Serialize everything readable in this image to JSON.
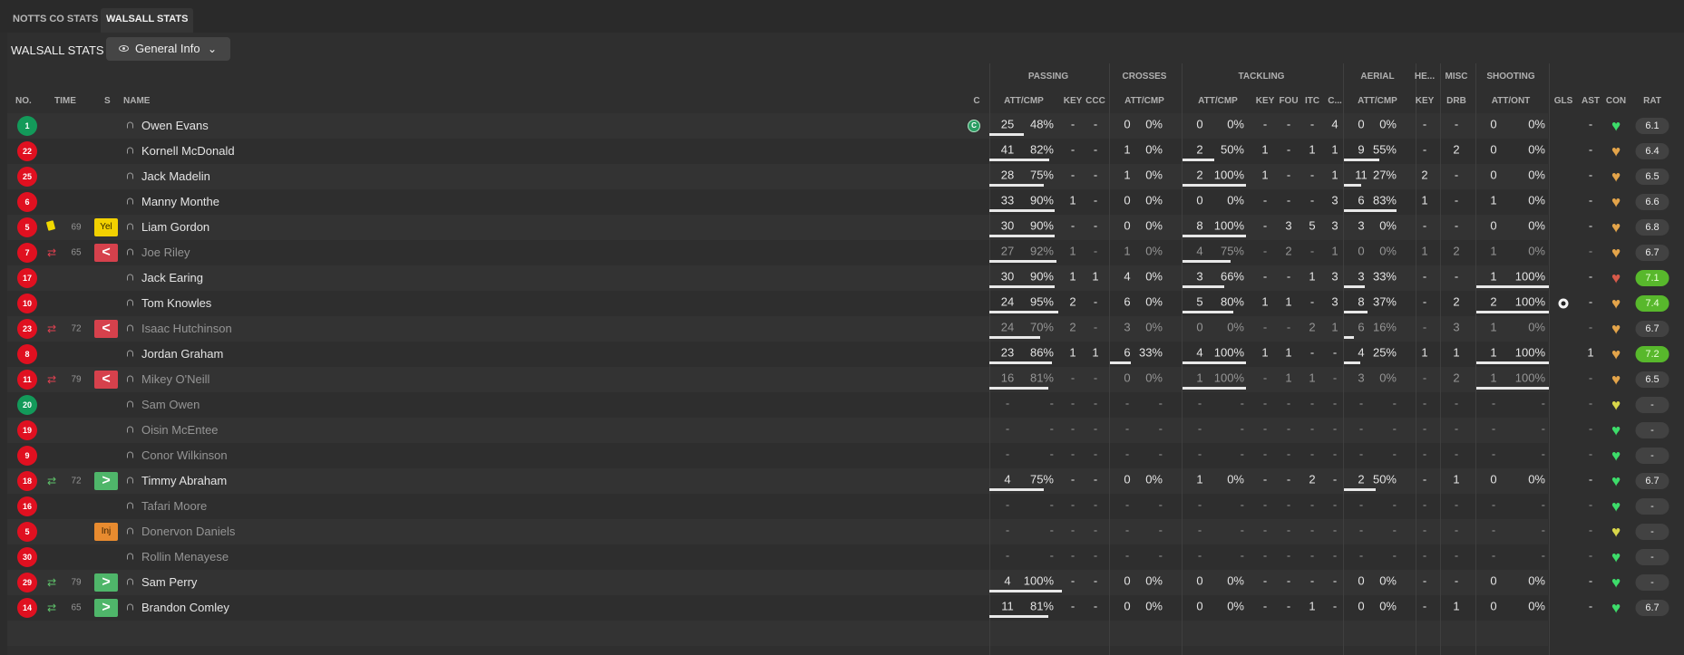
{
  "tabs": [
    {
      "label": "NOTTS CO STATS"
    },
    {
      "label": "WALSALL STATS"
    }
  ],
  "panel": {
    "title": "WALSALL STATS",
    "view": "General Info"
  },
  "colors": {
    "shirt_red": "#e01020",
    "shirt_green": "#139a5a",
    "rating_high": "#58b82c",
    "sub_off": "#d6414c",
    "sub_on": "#4fb66a",
    "yellow": "#f2d100",
    "injury": "#e88b2f"
  },
  "icons": {
    "eye": "eye-icon",
    "chevron": "chevron-down-icon",
    "person": "person-icon",
    "heart": "heart-icon",
    "captain": "captain-icon",
    "ball": "ball-icon",
    "sub_off": "sub-off-arrow-icon",
    "sub_on": "sub-on-arrow-icon",
    "yellow_card": "yellow-card-icon"
  },
  "groups": [
    "PASSING",
    "CROSSES",
    "TACKLING",
    "AERIAL",
    "HE...",
    "MISC",
    "SHOOTING"
  ],
  "columns": [
    "NO.",
    "TIME",
    "S",
    "NAME",
    "C",
    "ATT/CMP",
    "KEY",
    "CCC",
    "ATT/CMP",
    "ATT/CMP",
    "KEY",
    "FOU",
    "ITC",
    "C...",
    "ATT/CMP",
    "KEY",
    "DRB",
    "ATT/ONT",
    "GLS",
    "AST",
    "CON",
    "RAT"
  ],
  "players": [
    {
      "no": "1",
      "shirt": "green",
      "name": "Owen Evans",
      "captain": "C",
      "pass": [
        "25",
        "48%",
        0.48
      ],
      "pkey": "-",
      "ccc": "-",
      "cross": [
        "0",
        "0%",
        0
      ],
      "tack": [
        "0",
        "0%",
        0
      ],
      "tkey": "-",
      "fou": "-",
      "itc": "-",
      "tc": "4",
      "aer": [
        "0",
        "0%",
        0
      ],
      "hkey": "-",
      "drb": "-",
      "shoot": [
        "0",
        "0%",
        0
      ],
      "ast": "-",
      "heart": "green",
      "rat": "6.1"
    },
    {
      "no": "22",
      "name": "Kornell McDonald",
      "pass": [
        "41",
        "82%",
        0.82
      ],
      "pkey": "-",
      "ccc": "-",
      "cross": [
        "1",
        "0%",
        0
      ],
      "tack": [
        "2",
        "50%",
        0.5
      ],
      "tkey": "1",
      "fou": "-",
      "itc": "1",
      "tc": "1",
      "aer": [
        "9",
        "55%",
        0.55
      ],
      "hkey": "-",
      "drb": "2",
      "shoot": [
        "0",
        "0%",
        0
      ],
      "ast": "-",
      "heart": "orange",
      "rat": "6.4"
    },
    {
      "no": "25",
      "name": "Jack Madelin",
      "pass": [
        "28",
        "75%",
        0.75
      ],
      "pkey": "-",
      "ccc": "-",
      "cross": [
        "1",
        "0%",
        0
      ],
      "tack": [
        "2",
        "100%",
        1
      ],
      "tkey": "1",
      "fou": "-",
      "itc": "-",
      "tc": "1",
      "aer": [
        "11",
        "27%",
        0.27
      ],
      "hkey": "2",
      "drb": "-",
      "shoot": [
        "0",
        "0%",
        0
      ],
      "ast": "-",
      "heart": "orange",
      "rat": "6.5"
    },
    {
      "no": "6",
      "name": "Manny Monthe",
      "pass": [
        "33",
        "90%",
        0.9
      ],
      "pkey": "1",
      "ccc": "-",
      "cross": [
        "0",
        "0%",
        0
      ],
      "tack": [
        "0",
        "0%",
        0
      ],
      "tkey": "-",
      "fou": "-",
      "itc": "-",
      "tc": "3",
      "aer": [
        "6",
        "83%",
        0.83
      ],
      "hkey": "1",
      "drb": "-",
      "shoot": [
        "1",
        "0%",
        0
      ],
      "ast": "-",
      "heart": "orange",
      "rat": "6.6"
    },
    {
      "no": "5",
      "card": true,
      "time": "69",
      "badge": "Yel",
      "name": "Liam Gordon",
      "pass": [
        "30",
        "90%",
        0.9
      ],
      "pkey": "-",
      "ccc": "-",
      "cross": [
        "0",
        "0%",
        0
      ],
      "tack": [
        "8",
        "100%",
        1
      ],
      "tkey": "-",
      "fou": "3",
      "itc": "5",
      "tc": "3",
      "aer": [
        "3",
        "0%",
        0
      ],
      "hkey": "-",
      "drb": "-",
      "shoot": [
        "0",
        "0%",
        0
      ],
      "ast": "-",
      "heart": "orange",
      "rat": "6.8"
    },
    {
      "no": "7",
      "sub": "off",
      "time": "65",
      "badge": "<",
      "dim": true,
      "name": "Joe Riley",
      "pass": [
        "27",
        "92%",
        0.92
      ],
      "pkey": "1",
      "ccc": "-",
      "cross": [
        "1",
        "0%",
        0
      ],
      "tack": [
        "4",
        "75%",
        0.75
      ],
      "tkey": "-",
      "fou": "2",
      "itc": "-",
      "tc": "1",
      "aer": [
        "0",
        "0%",
        0
      ],
      "hkey": "1",
      "drb": "2",
      "shoot": [
        "1",
        "0%",
        0
      ],
      "ast": "-",
      "heart": "orange",
      "rat": "6.7"
    },
    {
      "no": "17",
      "name": "Jack Earing",
      "pass": [
        "30",
        "90%",
        0.9
      ],
      "pkey": "1",
      "ccc": "1",
      "cross": [
        "4",
        "0%",
        0
      ],
      "tack": [
        "3",
        "66%",
        0.66
      ],
      "tkey": "-",
      "fou": "-",
      "itc": "1",
      "tc": "3",
      "aer": [
        "3",
        "33%",
        0.33
      ],
      "hkey": "-",
      "drb": "-",
      "shoot": [
        "1",
        "100%",
        1
      ],
      "ast": "-",
      "heart": "red",
      "rat": "7.1",
      "rathi": true
    },
    {
      "no": "10",
      "name": "Tom Knowles",
      "pass": [
        "24",
        "95%",
        0.95
      ],
      "pkey": "2",
      "ccc": "-",
      "cross": [
        "6",
        "0%",
        0
      ],
      "tack": [
        "5",
        "80%",
        0.8
      ],
      "tkey": "1",
      "fou": "1",
      "itc": "-",
      "tc": "3",
      "aer": [
        "8",
        "37%",
        0.37
      ],
      "hkey": "-",
      "drb": "2",
      "shoot": [
        "2",
        "100%",
        1
      ],
      "goal": true,
      "ast": "-",
      "heart": "orange",
      "rat": "7.4",
      "rathi": true
    },
    {
      "no": "23",
      "sub": "off",
      "time": "72",
      "badge": "<",
      "dim": true,
      "name": "Isaac Hutchinson",
      "pass": [
        "24",
        "70%",
        0.7
      ],
      "pkey": "2",
      "ccc": "-",
      "cross": [
        "3",
        "0%",
        0
      ],
      "tack": [
        "0",
        "0%",
        0
      ],
      "tkey": "-",
      "fou": "-",
      "itc": "2",
      "tc": "1",
      "aer": [
        "6",
        "16%",
        0.16
      ],
      "hkey": "-",
      "drb": "3",
      "shoot": [
        "1",
        "0%",
        0
      ],
      "ast": "-",
      "heart": "orange",
      "rat": "6.7"
    },
    {
      "no": "8",
      "name": "Jordan Graham",
      "pass": [
        "23",
        "86%",
        0.86
      ],
      "pkey": "1",
      "ccc": "1",
      "cross": [
        "6",
        "33%",
        0.33
      ],
      "tack": [
        "4",
        "100%",
        1
      ],
      "tkey": "1",
      "fou": "1",
      "itc": "-",
      "tc": "-",
      "aer": [
        "4",
        "25%",
        0.25
      ],
      "hkey": "1",
      "drb": "1",
      "shoot": [
        "1",
        "100%",
        1
      ],
      "ast": "1",
      "heart": "orange",
      "rat": "7.2",
      "rathi": true
    },
    {
      "no": "11",
      "sub": "off",
      "time": "79",
      "badge": "<",
      "dim": true,
      "name": "Mikey O'Neill",
      "pass": [
        "16",
        "81%",
        0.81
      ],
      "pkey": "-",
      "ccc": "-",
      "cross": [
        "0",
        "0%",
        0
      ],
      "tack": [
        "1",
        "100%",
        1
      ],
      "tkey": "-",
      "fou": "1",
      "itc": "1",
      "tc": "-",
      "aer": [
        "3",
        "0%",
        0
      ],
      "hkey": "-",
      "drb": "2",
      "shoot": [
        "1",
        "100%",
        1
      ],
      "ast": "-",
      "heart": "orange",
      "rat": "6.5"
    },
    {
      "no": "20",
      "shirt": "green",
      "dim": true,
      "name": "Sam Owen",
      "pass": [
        "-",
        "-",
        0
      ],
      "pkey": "-",
      "ccc": "-",
      "cross": [
        "-",
        "-",
        0
      ],
      "tack": [
        "-",
        "-",
        0
      ],
      "tkey": "-",
      "fou": "-",
      "itc": "-",
      "tc": "-",
      "aer": [
        "-",
        "-",
        0
      ],
      "hkey": "-",
      "drb": "-",
      "shoot": [
        "-",
        "-",
        0
      ],
      "ast": "-",
      "heart": "yellow",
      "rat": "-"
    },
    {
      "no": "19",
      "dim": true,
      "name": "Oisin McEntee",
      "pass": [
        "-",
        "-",
        0
      ],
      "pkey": "-",
      "ccc": "-",
      "cross": [
        "-",
        "-",
        0
      ],
      "tack": [
        "-",
        "-",
        0
      ],
      "tkey": "-",
      "fou": "-",
      "itc": "-",
      "tc": "-",
      "aer": [
        "-",
        "-",
        0
      ],
      "hkey": "-",
      "drb": "-",
      "shoot": [
        "-",
        "-",
        0
      ],
      "ast": "-",
      "heart": "green",
      "rat": "-"
    },
    {
      "no": "9",
      "dim": true,
      "name": "Conor Wilkinson",
      "pass": [
        "-",
        "-",
        0
      ],
      "pkey": "-",
      "ccc": "-",
      "cross": [
        "-",
        "-",
        0
      ],
      "tack": [
        "-",
        "-",
        0
      ],
      "tkey": "-",
      "fou": "-",
      "itc": "-",
      "tc": "-",
      "aer": [
        "-",
        "-",
        0
      ],
      "hkey": "-",
      "drb": "-",
      "shoot": [
        "-",
        "-",
        0
      ],
      "ast": "-",
      "heart": "green",
      "rat": "-"
    },
    {
      "no": "18",
      "sub": "on",
      "time": "72",
      "badge": ">",
      "name": "Timmy Abraham",
      "pass": [
        "4",
        "75%",
        0.75
      ],
      "pkey": "-",
      "ccc": "-",
      "cross": [
        "0",
        "0%",
        0
      ],
      "tack": [
        "1",
        "0%",
        0
      ],
      "tkey": "-",
      "fou": "-",
      "itc": "2",
      "tc": "-",
      "aer": [
        "2",
        "50%",
        0.5
      ],
      "hkey": "-",
      "drb": "1",
      "shoot": [
        "0",
        "0%",
        0
      ],
      "ast": "-",
      "heart": "green",
      "rat": "6.7"
    },
    {
      "no": "16",
      "dim": true,
      "name": "Tafari Moore",
      "pass": [
        "-",
        "-",
        0
      ],
      "pkey": "-",
      "ccc": "-",
      "cross": [
        "-",
        "-",
        0
      ],
      "tack": [
        "-",
        "-",
        0
      ],
      "tkey": "-",
      "fou": "-",
      "itc": "-",
      "tc": "-",
      "aer": [
        "-",
        "-",
        0
      ],
      "hkey": "-",
      "drb": "-",
      "shoot": [
        "-",
        "-",
        0
      ],
      "ast": "-",
      "heart": "green",
      "rat": "-"
    },
    {
      "no": "5",
      "badge": "Inj",
      "dim": true,
      "name": "Donervon Daniels",
      "pass": [
        "-",
        "-",
        0
      ],
      "pkey": "-",
      "ccc": "-",
      "cross": [
        "-",
        "-",
        0
      ],
      "tack": [
        "-",
        "-",
        0
      ],
      "tkey": "-",
      "fou": "-",
      "itc": "-",
      "tc": "-",
      "aer": [
        "-",
        "-",
        0
      ],
      "hkey": "-",
      "drb": "-",
      "shoot": [
        "-",
        "-",
        0
      ],
      "ast": "-",
      "heart": "yellow",
      "rat": "-"
    },
    {
      "no": "30",
      "dim": true,
      "name": "Rollin Menayese",
      "pass": [
        "-",
        "-",
        0
      ],
      "pkey": "-",
      "ccc": "-",
      "cross": [
        "-",
        "-",
        0
      ],
      "tack": [
        "-",
        "-",
        0
      ],
      "tkey": "-",
      "fou": "-",
      "itc": "-",
      "tc": "-",
      "aer": [
        "-",
        "-",
        0
      ],
      "hkey": "-",
      "drb": "-",
      "shoot": [
        "-",
        "-",
        0
      ],
      "ast": "-",
      "heart": "green",
      "rat": "-"
    },
    {
      "no": "29",
      "sub": "on",
      "time": "79",
      "badge": ">",
      "name": "Sam Perry",
      "pass": [
        "4",
        "100%",
        1
      ],
      "pkey": "-",
      "ccc": "-",
      "cross": [
        "0",
        "0%",
        0
      ],
      "tack": [
        "0",
        "0%",
        0
      ],
      "tkey": "-",
      "fou": "-",
      "itc": "-",
      "tc": "-",
      "aer": [
        "0",
        "0%",
        0
      ],
      "hkey": "-",
      "drb": "-",
      "shoot": [
        "0",
        "0%",
        0
      ],
      "ast": "-",
      "heart": "green",
      "rat": "-"
    },
    {
      "no": "14",
      "sub": "on",
      "time": "65",
      "badge": ">",
      "name": "Brandon Comley",
      "pass": [
        "11",
        "81%",
        0.81
      ],
      "pkey": "-",
      "ccc": "-",
      "cross": [
        "0",
        "0%",
        0
      ],
      "tack": [
        "0",
        "0%",
        0
      ],
      "tkey": "-",
      "fou": "-",
      "itc": "1",
      "tc": "-",
      "aer": [
        "0",
        "0%",
        0
      ],
      "hkey": "-",
      "drb": "1",
      "shoot": [
        "0",
        "0%",
        0
      ],
      "ast": "-",
      "heart": "green",
      "rat": "6.7"
    }
  ]
}
